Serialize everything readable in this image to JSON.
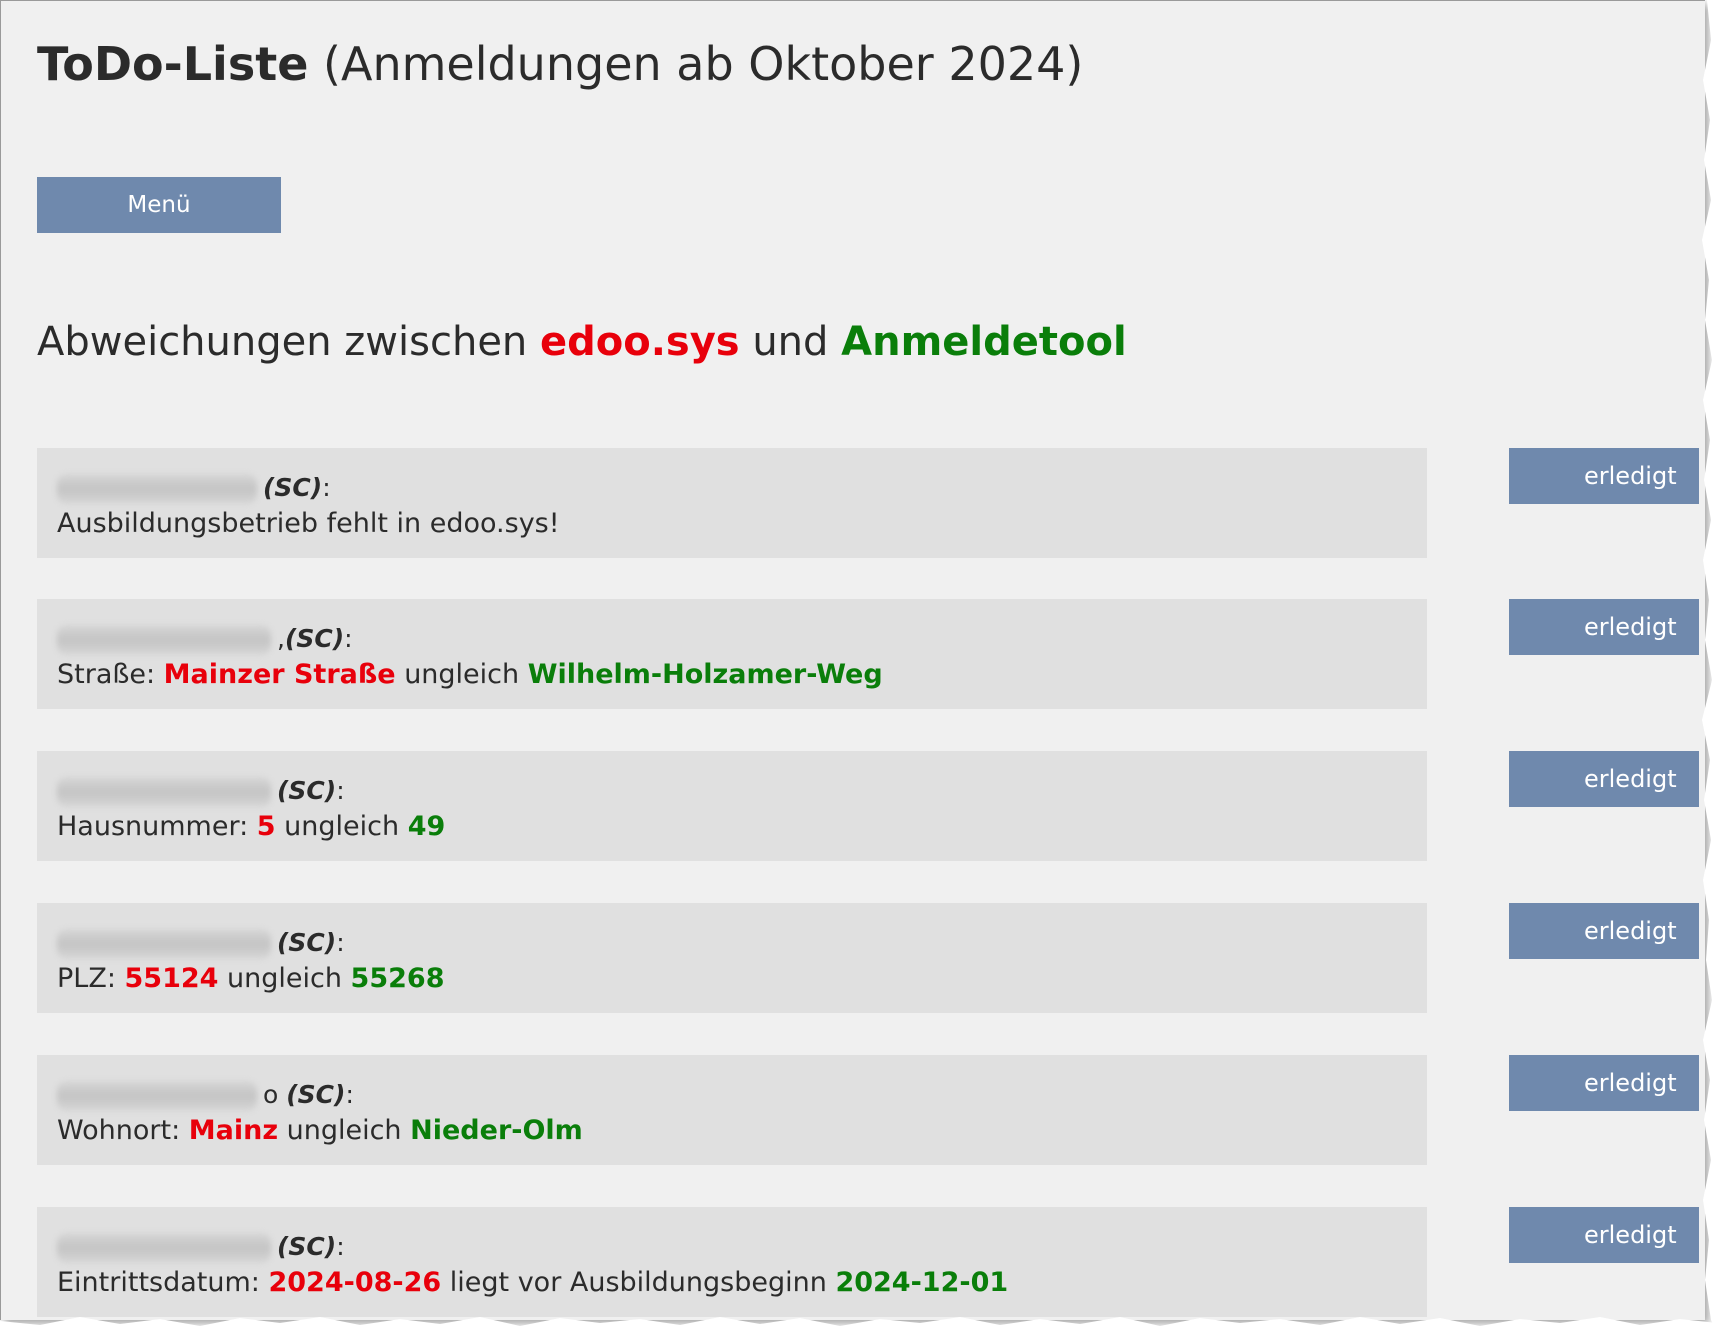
{
  "header": {
    "title_bold": "ToDo-Liste",
    "title_rest": " (Anmeldungen ab Oktober 2024)"
  },
  "menu": {
    "label": "Menü"
  },
  "section": {
    "prefix": "Abweichungen zwischen ",
    "source_a": "edoo.sys",
    "middle": " und ",
    "source_b": "Anmeldetool"
  },
  "colors": {
    "page_bg": "#f0f0f0",
    "row_bg": "#e0e0e0",
    "button_bg": "#6f89ad",
    "edoo_red": "#e8000b",
    "tool_green": "#0a7e0a"
  },
  "entries": [
    {
      "name_suffix": "",
      "tag": "(SC)",
      "colon": ":",
      "detail_plain": "Ausbildungsbetrieb fehlt in edoo.sys!",
      "done_label": "erledigt"
    },
    {
      "name_suffix": ",",
      "tag": "(SC)",
      "colon": ":",
      "field": "Straße: ",
      "value_edoo": "Mainzer Straße",
      "connector": " ungleich ",
      "value_tool": "Wilhelm-Holzamer-Weg",
      "done_label": "erledigt"
    },
    {
      "name_suffix": "",
      "tag": "(SC)",
      "colon": ":",
      "field": "Hausnummer: ",
      "value_edoo": "5",
      "connector": " ungleich ",
      "value_tool": "49",
      "done_label": "erledigt"
    },
    {
      "name_suffix": "",
      "tag": "(SC)",
      "colon": ":",
      "field": "PLZ: ",
      "value_edoo": "55124",
      "connector": " ungleich ",
      "value_tool": "55268",
      "done_label": "erledigt"
    },
    {
      "name_suffix": "o",
      "tag": "(SC)",
      "colon": ":",
      "field": "Wohnort: ",
      "value_edoo": "Mainz",
      "connector": " ungleich ",
      "value_tool": "Nieder-Olm",
      "done_label": "erledigt"
    },
    {
      "name_suffix": "",
      "tag": "(SC)",
      "colon": ":",
      "field": "Eintrittsdatum: ",
      "value_edoo": "2024-08-26",
      "connector": " liegt vor Ausbildungsbeginn ",
      "value_tool": "2024-12-01",
      "done_label": "erledigt"
    }
  ]
}
